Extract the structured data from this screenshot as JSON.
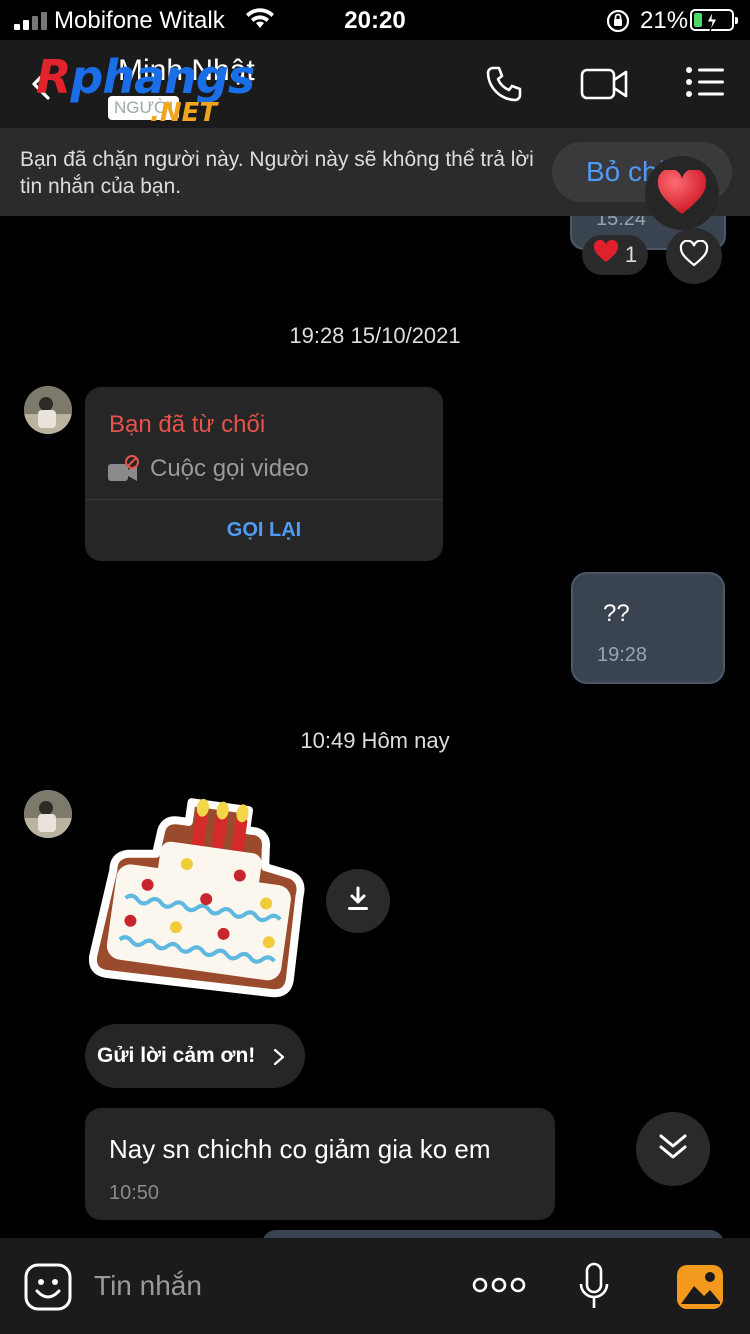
{
  "status_bar": {
    "carrier": "Mobifone Witalk",
    "time": "20:20",
    "battery": "21%",
    "battery_level": 0.21
  },
  "header": {
    "title": "Minh Nhật",
    "subtitle": "NGƯỜI",
    "logo_main_r": "R",
    "logo_main_rest": "phangs",
    "logo_suffix": ".NET",
    "icons": [
      "back-icon",
      "phone-icon",
      "video-call-icon",
      "menu-icon"
    ]
  },
  "banner": {
    "text": "Bạn đã chặn người này. Người này sẽ không thể trả lời tin nhắn của bạn.",
    "button": "Bỏ chặn"
  },
  "messages": {
    "prev_time": "15:24",
    "reaction_count": "1",
    "date_1": "19:28 15/10/2021",
    "call_card": {
      "title": "Bạn đã từ chối",
      "subtitle": "Cuộc gọi video",
      "action": "GỌI LẠI"
    },
    "my_msg": {
      "text": "??",
      "time": "19:28"
    },
    "date_2": "10:49 Hôm nay",
    "thanks_button": "Gửi lời cảm ơn!",
    "in_msg": {
      "text": "Nay sn chichh co giảm gia ko em",
      "time": "10:50"
    }
  },
  "composer": {
    "placeholder": "Tin nhắn"
  },
  "colors": {
    "accent_blue": "#4f9cf7",
    "declined_red": "#e5534b",
    "outgoing_bubble": "#3a4350",
    "incoming_bubble": "#262626",
    "battery_green": "#4cd964"
  }
}
